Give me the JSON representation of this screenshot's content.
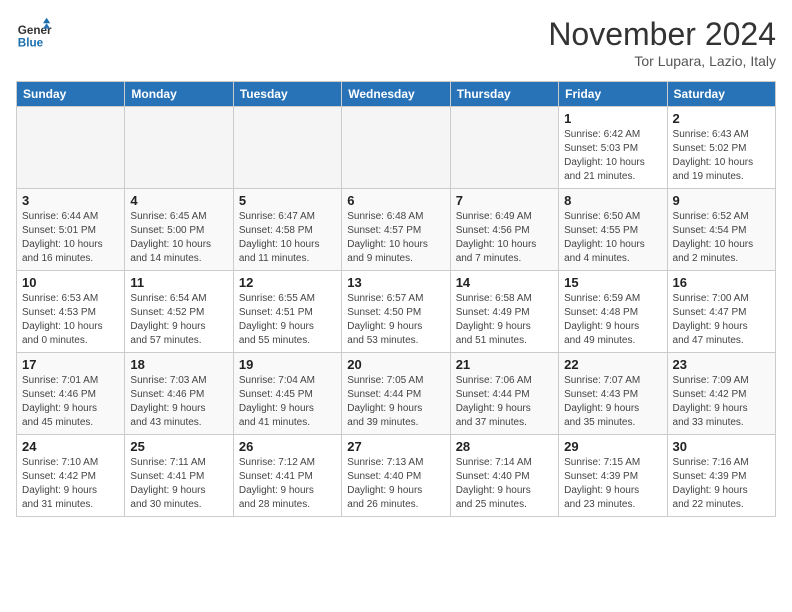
{
  "header": {
    "logo_line1": "General",
    "logo_line2": "Blue",
    "month": "November 2024",
    "location": "Tor Lupara, Lazio, Italy"
  },
  "weekdays": [
    "Sunday",
    "Monday",
    "Tuesday",
    "Wednesday",
    "Thursday",
    "Friday",
    "Saturday"
  ],
  "weeks": [
    [
      {
        "day": "",
        "info": ""
      },
      {
        "day": "",
        "info": ""
      },
      {
        "day": "",
        "info": ""
      },
      {
        "day": "",
        "info": ""
      },
      {
        "day": "",
        "info": ""
      },
      {
        "day": "1",
        "info": "Sunrise: 6:42 AM\nSunset: 5:03 PM\nDaylight: 10 hours\nand 21 minutes."
      },
      {
        "day": "2",
        "info": "Sunrise: 6:43 AM\nSunset: 5:02 PM\nDaylight: 10 hours\nand 19 minutes."
      }
    ],
    [
      {
        "day": "3",
        "info": "Sunrise: 6:44 AM\nSunset: 5:01 PM\nDaylight: 10 hours\nand 16 minutes."
      },
      {
        "day": "4",
        "info": "Sunrise: 6:45 AM\nSunset: 5:00 PM\nDaylight: 10 hours\nand 14 minutes."
      },
      {
        "day": "5",
        "info": "Sunrise: 6:47 AM\nSunset: 4:58 PM\nDaylight: 10 hours\nand 11 minutes."
      },
      {
        "day": "6",
        "info": "Sunrise: 6:48 AM\nSunset: 4:57 PM\nDaylight: 10 hours\nand 9 minutes."
      },
      {
        "day": "7",
        "info": "Sunrise: 6:49 AM\nSunset: 4:56 PM\nDaylight: 10 hours\nand 7 minutes."
      },
      {
        "day": "8",
        "info": "Sunrise: 6:50 AM\nSunset: 4:55 PM\nDaylight: 10 hours\nand 4 minutes."
      },
      {
        "day": "9",
        "info": "Sunrise: 6:52 AM\nSunset: 4:54 PM\nDaylight: 10 hours\nand 2 minutes."
      }
    ],
    [
      {
        "day": "10",
        "info": "Sunrise: 6:53 AM\nSunset: 4:53 PM\nDaylight: 10 hours\nand 0 minutes."
      },
      {
        "day": "11",
        "info": "Sunrise: 6:54 AM\nSunset: 4:52 PM\nDaylight: 9 hours\nand 57 minutes."
      },
      {
        "day": "12",
        "info": "Sunrise: 6:55 AM\nSunset: 4:51 PM\nDaylight: 9 hours\nand 55 minutes."
      },
      {
        "day": "13",
        "info": "Sunrise: 6:57 AM\nSunset: 4:50 PM\nDaylight: 9 hours\nand 53 minutes."
      },
      {
        "day": "14",
        "info": "Sunrise: 6:58 AM\nSunset: 4:49 PM\nDaylight: 9 hours\nand 51 minutes."
      },
      {
        "day": "15",
        "info": "Sunrise: 6:59 AM\nSunset: 4:48 PM\nDaylight: 9 hours\nand 49 minutes."
      },
      {
        "day": "16",
        "info": "Sunrise: 7:00 AM\nSunset: 4:47 PM\nDaylight: 9 hours\nand 47 minutes."
      }
    ],
    [
      {
        "day": "17",
        "info": "Sunrise: 7:01 AM\nSunset: 4:46 PM\nDaylight: 9 hours\nand 45 minutes."
      },
      {
        "day": "18",
        "info": "Sunrise: 7:03 AM\nSunset: 4:46 PM\nDaylight: 9 hours\nand 43 minutes."
      },
      {
        "day": "19",
        "info": "Sunrise: 7:04 AM\nSunset: 4:45 PM\nDaylight: 9 hours\nand 41 minutes."
      },
      {
        "day": "20",
        "info": "Sunrise: 7:05 AM\nSunset: 4:44 PM\nDaylight: 9 hours\nand 39 minutes."
      },
      {
        "day": "21",
        "info": "Sunrise: 7:06 AM\nSunset: 4:44 PM\nDaylight: 9 hours\nand 37 minutes."
      },
      {
        "day": "22",
        "info": "Sunrise: 7:07 AM\nSunset: 4:43 PM\nDaylight: 9 hours\nand 35 minutes."
      },
      {
        "day": "23",
        "info": "Sunrise: 7:09 AM\nSunset: 4:42 PM\nDaylight: 9 hours\nand 33 minutes."
      }
    ],
    [
      {
        "day": "24",
        "info": "Sunrise: 7:10 AM\nSunset: 4:42 PM\nDaylight: 9 hours\nand 31 minutes."
      },
      {
        "day": "25",
        "info": "Sunrise: 7:11 AM\nSunset: 4:41 PM\nDaylight: 9 hours\nand 30 minutes."
      },
      {
        "day": "26",
        "info": "Sunrise: 7:12 AM\nSunset: 4:41 PM\nDaylight: 9 hours\nand 28 minutes."
      },
      {
        "day": "27",
        "info": "Sunrise: 7:13 AM\nSunset: 4:40 PM\nDaylight: 9 hours\nand 26 minutes."
      },
      {
        "day": "28",
        "info": "Sunrise: 7:14 AM\nSunset: 4:40 PM\nDaylight: 9 hours\nand 25 minutes."
      },
      {
        "day": "29",
        "info": "Sunrise: 7:15 AM\nSunset: 4:39 PM\nDaylight: 9 hours\nand 23 minutes."
      },
      {
        "day": "30",
        "info": "Sunrise: 7:16 AM\nSunset: 4:39 PM\nDaylight: 9 hours\nand 22 minutes."
      }
    ]
  ]
}
